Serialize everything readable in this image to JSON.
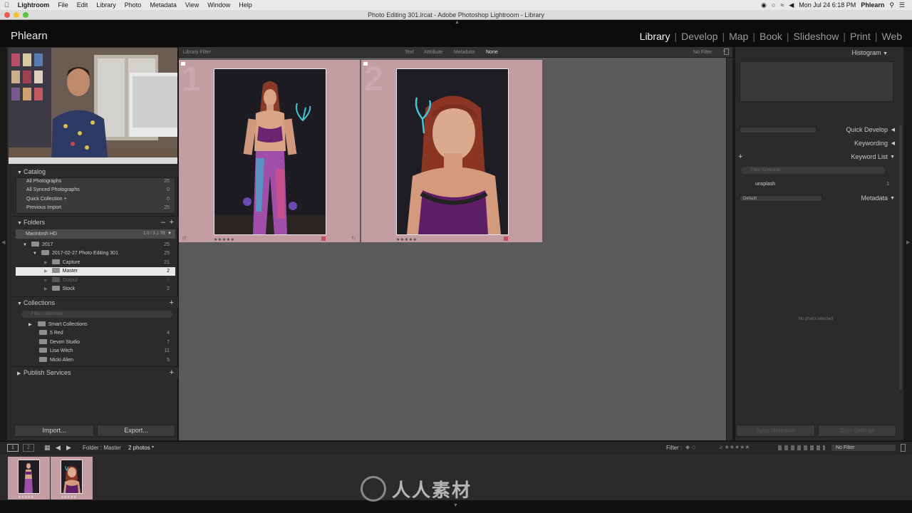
{
  "mac_menubar": {
    "apple_icon": "apple-icon",
    "app": "Lightroom",
    "items": [
      "File",
      "Edit",
      "Library",
      "Photo",
      "Metadata",
      "View",
      "Window",
      "Help"
    ],
    "clock": "Mon Jul 24  6:18 PM",
    "user": "Phlearn"
  },
  "window": {
    "title": "Photo Editing 301.lrcat - Adobe Photoshop Lightroom - Library"
  },
  "identity": {
    "brand": "Phlearn"
  },
  "modules": {
    "active": "Library",
    "items": [
      "Library",
      "Develop",
      "Map",
      "Book",
      "Slideshow",
      "Print",
      "Web"
    ]
  },
  "left_panel": {
    "catalog": {
      "title": "Catalog",
      "items": [
        {
          "label": "All Photographs",
          "count": "25"
        },
        {
          "label": "All Synced Photographs",
          "count": "0"
        },
        {
          "label": "Quick Collection +",
          "count": "0"
        },
        {
          "label": "Previous Import",
          "count": "25"
        }
      ]
    },
    "folders": {
      "title": "Folders",
      "volume": {
        "label": "Macintosh HD",
        "size": "1.0 / 3.1 TB"
      },
      "items": [
        {
          "label": "2017",
          "count": "25"
        },
        {
          "label": "2017-02-27 Photo Editing 301",
          "count": "25"
        },
        {
          "label": "Capture",
          "count": "21"
        },
        {
          "label": "Master",
          "count": "2",
          "selected": true
        },
        {
          "label": "Output",
          "count": "0"
        },
        {
          "label": "Stock",
          "count": "2"
        }
      ]
    },
    "collections": {
      "title": "Collections",
      "filter_placeholder": "Filter Collections",
      "items": [
        {
          "label": "Smart Collections",
          "count": ""
        },
        {
          "label": "5 Red",
          "count": "4"
        },
        {
          "label": "Devon Studio",
          "count": "7"
        },
        {
          "label": "Lisa Witch",
          "count": "11"
        },
        {
          "label": "Micki Alien",
          "count": "5"
        }
      ]
    },
    "publish": {
      "title": "Publish Services"
    },
    "import_button": "Import...",
    "export_button": "Export..."
  },
  "library_filter": {
    "label": "Library Filter :",
    "tabs": [
      "Text",
      "Attribute",
      "Metadata",
      "None"
    ],
    "active_tab": "None",
    "preset": "No Filter"
  },
  "grid": {
    "cells": [
      {
        "index": "1",
        "rating": "★★★★★"
      },
      {
        "index": "2",
        "rating": "★★★★★"
      }
    ]
  },
  "right_panel": {
    "histogram": "Histogram",
    "quick_develop": "Quick Develop",
    "keywording": "Keywording",
    "keyword_list": "Keyword List",
    "keyword_filter_placeholder": "Filter Keywords",
    "keywords": [
      {
        "label": "unsplash",
        "count": "1"
      }
    ],
    "metadata": "Metadata",
    "metadata_preset": "Default",
    "no_photo": "No photo selected",
    "sync_metadata": "Sync Metadata",
    "sync_settings": "Sync Settings"
  },
  "toolbar": {
    "view1": "1",
    "view2": "2",
    "source": "Folder : Master",
    "count": "2 photos",
    "filter_label": "Filter :",
    "filter_value": "No Filter"
  },
  "filmstrip": {
    "ratings": [
      "★★★★★",
      "★★★★★"
    ]
  },
  "watermark": {
    "text": "人人素材"
  },
  "colors": {
    "grid_bg": "#5a5a5a",
    "cell_label": "#c49da2",
    "panel_bg": "#2b2b2b",
    "active_module": "#f2f2f2"
  }
}
